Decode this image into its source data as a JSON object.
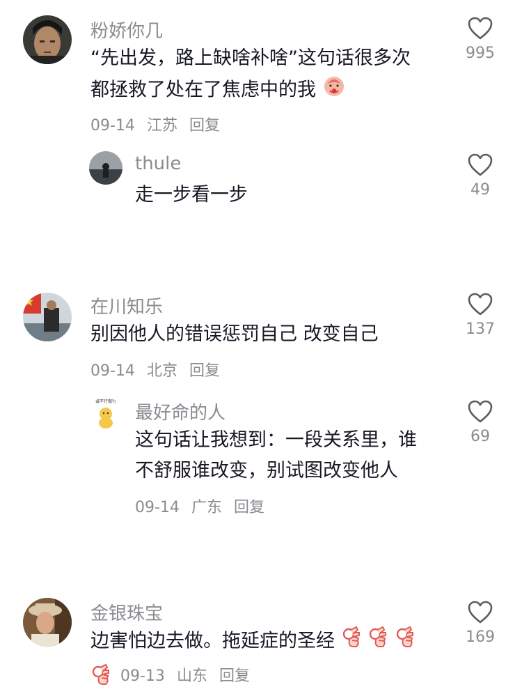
{
  "comments": [
    {
      "username": "粉娇你几",
      "text_line1": "“先出发，路上缺啥补啥”这句话很多次",
      "text_line2": "都拯救了处在了焦虑中的我",
      "date": "09-14",
      "location": "江苏",
      "reply_label": "回复",
      "likes": "995",
      "reply": {
        "username": "thule",
        "text": "走一步看一步",
        "likes": "49"
      }
    },
    {
      "username": "在川知乐",
      "text_line1": "别因他人的错误惩罚自己 改变自己",
      "date": "09-14",
      "location": "北京",
      "reply_label": "回复",
      "likes": "137",
      "reply": {
        "username": "最好命的人",
        "text_line1": "这句话让我想到：一段关系里，谁",
        "text_line2": "不舒服谁改变，别试图改变他人",
        "date": "09-14",
        "location": "广东",
        "reply_label": "回复",
        "likes": "69",
        "avatar_text": "做不行做行"
      }
    },
    {
      "username": "金银珠宝",
      "text_line1": "边害怕边去做。拖延症的圣经",
      "date": "09-13",
      "location": "山东",
      "reply_label": "回复",
      "likes": "169"
    }
  ],
  "icons": {
    "like": "heart-outline-icon",
    "emoji_blessing": "blessing-emoji-icon",
    "emoji_ok": "ok-hand-emoji-icon"
  },
  "colors": {
    "text_primary": "#161823",
    "text_secondary": "#8a8b91",
    "background": "#ffffff"
  }
}
